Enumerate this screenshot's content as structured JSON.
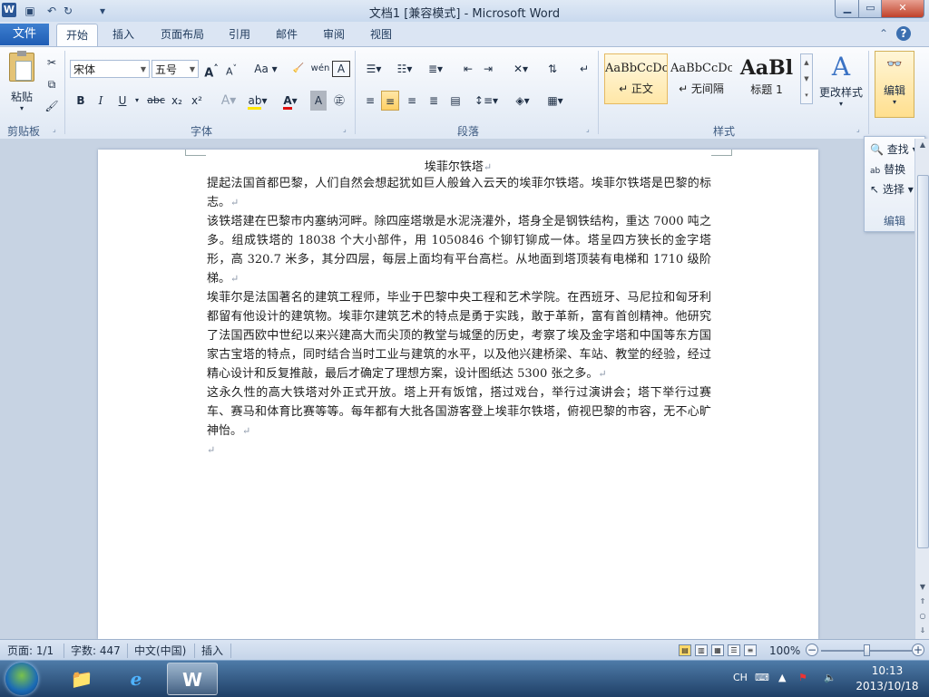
{
  "window": {
    "title": "文档1 [兼容模式] - Microsoft Word",
    "app_icon": "W",
    "quick_access": [
      "save-icon",
      "undo-icon",
      "redo-icon",
      "customize-icon"
    ]
  },
  "tabs": {
    "file": "文件",
    "items": [
      "开始",
      "插入",
      "页面布局",
      "引用",
      "邮件",
      "审阅",
      "视图"
    ],
    "active": "开始"
  },
  "ribbon": {
    "clipboard": {
      "label": "剪贴板",
      "paste": "粘贴"
    },
    "font": {
      "label": "字体",
      "font_name": "宋体",
      "font_size": "五号",
      "buttons": [
        "A",
        "A",
        "Aa",
        "wén",
        "A"
      ],
      "format": [
        "B",
        "I",
        "U",
        "abc",
        "x₂",
        "x²"
      ]
    },
    "paragraph": {
      "label": "段落"
    },
    "styles": {
      "label": "样式",
      "items": [
        {
          "sample": "AaBbCcDc",
          "name": "↵ 正文"
        },
        {
          "sample": "AaBbCcDc",
          "name": "↵ 无间隔"
        },
        {
          "sample": "AaBl",
          "name": "标题 1"
        }
      ],
      "change_styles": "更改样式"
    },
    "editing": {
      "label": "编辑",
      "button": "编辑"
    }
  },
  "edit_panel": {
    "find": "查找",
    "replace": "替换",
    "select": "选择",
    "label": "编辑"
  },
  "document": {
    "title": "埃菲尔铁塔",
    "paragraphs": [
      "提起法国首都巴黎，人们自然会想起犹如巨人般耸入云天的埃菲尔铁塔。埃菲尔铁塔是巴黎的标志。",
      "该铁塔建在巴黎市内塞纳河畔。除四座塔墩是水泥浇灌外，塔身全是钢铁结构，重达 7000 吨之多。组成铁塔的 18038 个大小部件，用 1050846 个铆钉铆成一体。塔呈四方狭长的金字塔形，高 320.7 米多，其分四层，每层上面均有平台高栏。从地面到塔顶装有电梯和 1710 级阶梯。",
      "埃菲尔是法国著名的建筑工程师，毕业于巴黎中央工程和艺术学院。在西班牙、马尼拉和匈牙利都留有他设计的建筑物。埃菲尔建筑艺术的特点是勇于实践，敢于革新，富有首创精神。他研究了法国西欧中世纪以来兴建高大而尖顶的教堂与城堡的历史，考察了埃及金字塔和中国等东方国家古宝塔的特点，同时结合当时工业与建筑的水平，以及他兴建桥梁、车站、教堂的经验，经过精心设计和反复推敲，最后才确定了理想方案，设计图纸达 5300 张之多。",
      "这永久性的高大铁塔对外正式开放。塔上开有饭馆，搭过戏台，举行过演讲会；塔下举行过赛车、赛马和体育比赛等等。每年都有大批各国游客登上埃菲尔铁塔，俯视巴黎的市容，无不心旷神怡。"
    ],
    "paragraph_mark": "↵"
  },
  "status": {
    "page": "页面: 1/1",
    "words": "字数: 447",
    "language": "中文(中国)",
    "mode": "插入",
    "zoom": "100%",
    "zoom_level": 100
  },
  "taskbar": {
    "apps": [
      "explorer-icon",
      "ie-icon",
      "word-icon"
    ],
    "ime": "CH",
    "time": "10:13",
    "date": "2013/10/18"
  }
}
